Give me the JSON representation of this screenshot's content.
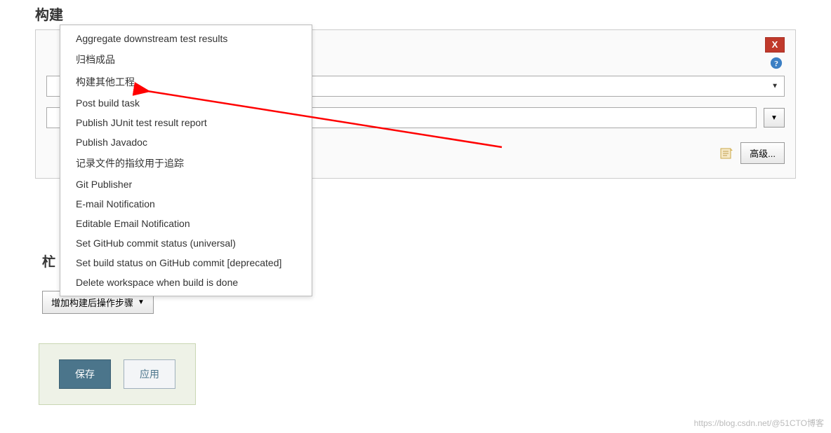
{
  "section_title": "构建",
  "truncated_heading": "杧",
  "close_label": "X",
  "advanced_label": "高级...",
  "add_step_label": "增加构建后操作步骤",
  "save_label": "保存",
  "apply_label": "应用",
  "watermark": "https://blog.csdn.net/@51CTO博客",
  "dropdown": {
    "items": [
      "Aggregate downstream test results",
      "归档成品",
      "构建其他工程",
      "Post build task",
      "Publish JUnit test result report",
      "Publish Javadoc",
      "记录文件的指纹用于追踪",
      "Git Publisher",
      "E-mail Notification",
      "Editable Email Notification",
      "Set GitHub commit status (universal)",
      "Set build status on GitHub commit [deprecated]",
      "Delete workspace when build is done"
    ]
  }
}
